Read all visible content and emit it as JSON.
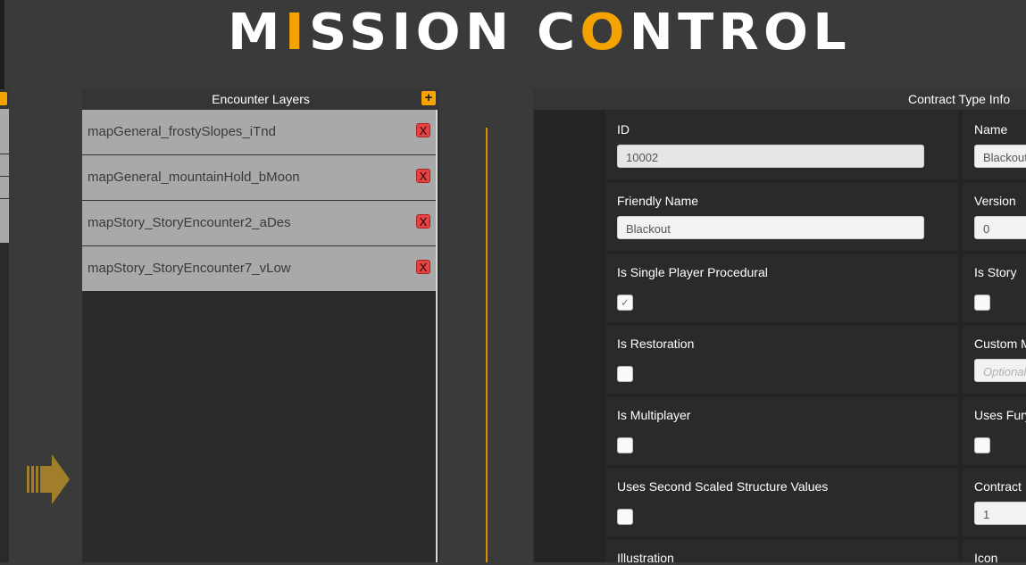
{
  "app": {
    "title_parts": [
      "M",
      "I",
      "SSI",
      "O",
      "N C",
      "O",
      "NTR",
      "O",
      "L"
    ],
    "title_full": "MISSION CONTROL",
    "accent_color": "#f5a300"
  },
  "encounter_layers": {
    "title": "Encounter Layers",
    "add_label": "+",
    "remove_label": "X",
    "items": [
      {
        "label": "mapGeneral_frostySlopes_iTnd"
      },
      {
        "label": "mapGeneral_mountainHold_bMoon"
      },
      {
        "label": "mapStory_StoryEncounter2_aDes"
      },
      {
        "label": "mapStory_StoryEncounter7_vLow"
      }
    ]
  },
  "contract_type_info": {
    "title": "Contract Type Info",
    "fields": {
      "id": {
        "label": "ID",
        "value": "10002"
      },
      "name": {
        "label": "Name",
        "value": "Blackout"
      },
      "friendly_name": {
        "label": "Friendly Name",
        "value": "Blackout"
      },
      "version": {
        "label": "Version",
        "value": "0"
      },
      "is_single_player_procedural": {
        "label": "Is Single Player Procedural",
        "checked": true
      },
      "is_story": {
        "label": "Is Story",
        "checked": false
      },
      "is_restoration": {
        "label": "Is Restoration",
        "checked": false
      },
      "custom_m": {
        "label": "Custom M",
        "placeholder": "Optional"
      },
      "is_multiplayer": {
        "label": "Is Multiplayer",
        "checked": false
      },
      "uses_fury": {
        "label": "Uses Fury",
        "checked": false
      },
      "uses_second_scaled": {
        "label": "Uses Second Scaled Structure Values",
        "checked": false
      },
      "contract": {
        "label": "Contract",
        "value": "1"
      },
      "illustration": {
        "label": "Illustration"
      },
      "icon": {
        "label": "Icon"
      }
    }
  },
  "checkmark_glyph": "✓"
}
